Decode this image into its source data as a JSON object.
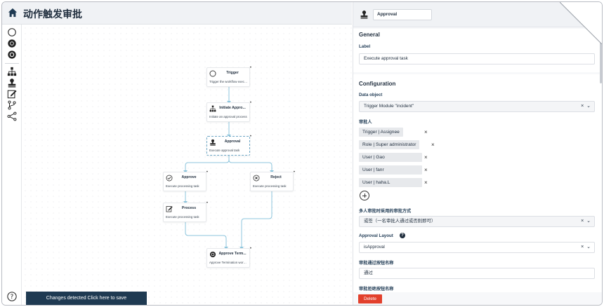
{
  "header": {
    "title": "动作触发审批"
  },
  "toolbar": {
    "tools": [
      "circle-empty-icon",
      "circle-filled-icon",
      "circle-ring-icon",
      "hierarchy-icon",
      "approval-stamp-icon",
      "edit-icon",
      "branch-icon",
      "share-icon"
    ],
    "help": "help-icon"
  },
  "canvas": {
    "nodes": {
      "trigger": {
        "title": "Trigger",
        "desc": "Trigger the workflow execu..."
      },
      "initiate": {
        "title": "Initiate Appro...",
        "desc": "Initiate an approval process"
      },
      "approval": {
        "title": "Approval",
        "desc": "Execute approval task"
      },
      "approve": {
        "title": "Approve",
        "desc": "Execute processing task"
      },
      "reject": {
        "title": "Reject",
        "desc": "Execute processing task"
      },
      "process": {
        "title": "Process",
        "desc": "Execute processing task"
      },
      "terminate": {
        "title": "Approve Term...",
        "desc": "Approve Termination workf..."
      }
    },
    "menu": "•"
  },
  "save_bar": {
    "label": "Changes detected Click here to save"
  },
  "panel": {
    "node_name": "Approval",
    "general": {
      "title": "General",
      "label_label": "Label",
      "label_value": "Execute approval task"
    },
    "configuration": {
      "title": "Configuration",
      "data_object_label": "Data object",
      "data_object_value": "Trigger Module \"incident\"",
      "approvers_label": "审批人",
      "approvers": [
        "Trigger | Assignee",
        "Role | Super administrator",
        "User | Gao",
        "User | fanr",
        "User | haha.L"
      ],
      "multi_label": "多人审批时采用的审批方式",
      "multi_value": "或签（一名审批人通过或否则即可）",
      "layout_label": "Approval Layout",
      "layout_value": "isApproval",
      "pass_label": "审批通过按钮名称",
      "pass_value": "通过",
      "reject_label": "审批拒绝按钮名称"
    },
    "clear_symbol": "×",
    "chevron": "⌄",
    "delete_label": "Delete"
  }
}
